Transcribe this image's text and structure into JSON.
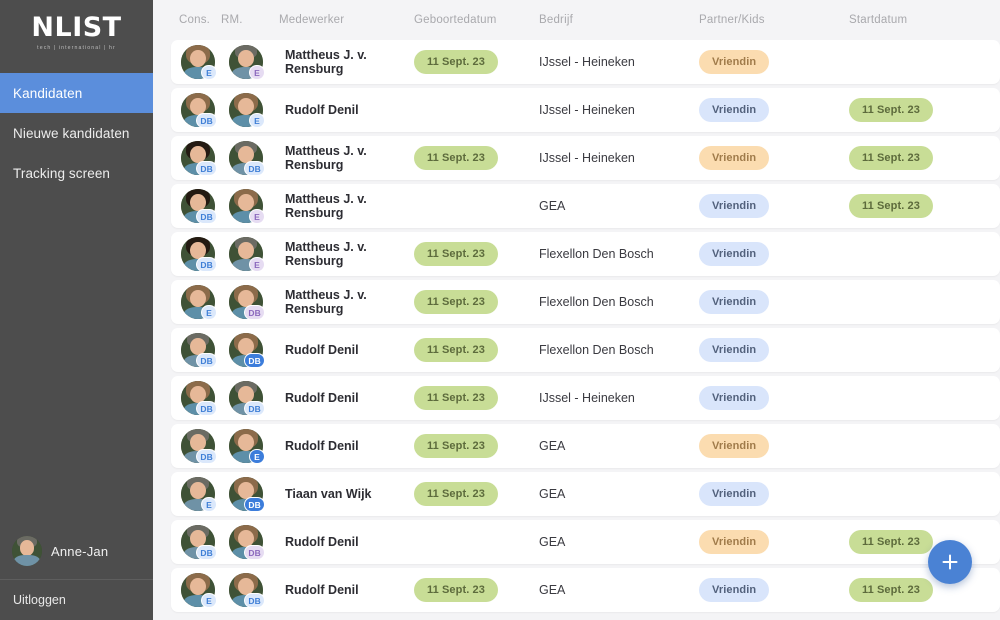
{
  "brand": {
    "logo": "NLIST",
    "tagline": "tech | international | hr"
  },
  "sidebar": {
    "items": [
      {
        "label": "Kandidaten",
        "active": true
      },
      {
        "label": "Nieuwe kandidaten",
        "active": false
      },
      {
        "label": "Tracking screen",
        "active": false
      }
    ],
    "user": {
      "name": "Anne-Jan"
    },
    "logout_label": "Uitloggen"
  },
  "colors": {
    "sidebar_bg": "#4d4d4d",
    "accent_blue": "#5b8edc",
    "page_bg": "#f4f4f6",
    "row_bg": "#ffffff",
    "chip_green_bg": "#c8dd96",
    "chip_green_text": "#5d6b3c",
    "chip_blue_bg": "#d9e5fb",
    "chip_blue_text": "#52617c",
    "chip_orange_bg": "#fbdcb0",
    "chip_orange_text": "#a07b4a",
    "fab_blue": "#4a82d4"
  },
  "table": {
    "columns": [
      {
        "key": "cons",
        "label": "Cons."
      },
      {
        "key": "rm",
        "label": "RM."
      },
      {
        "key": "name",
        "label": "Medewerker"
      },
      {
        "key": "geb",
        "label": "Geboortedatum"
      },
      {
        "key": "bedr",
        "label": "Bedrijf"
      },
      {
        "key": "part",
        "label": "Partner/Kids"
      },
      {
        "key": "start",
        "label": "Startdatum"
      }
    ],
    "rows": [
      {
        "cons_badge": "E",
        "cons_badge_style": "blue",
        "rm_badge": "E",
        "rm_badge_style": "purple",
        "name": "Mattheus J. v. Rensburg",
        "geboortedatum": "11 Sept. 23",
        "geboortedatum_style": "green",
        "bedrijf": "IJssel - Heineken",
        "partner": "Vriendin",
        "partner_style": "orange",
        "startdatum": "",
        "startdatum_style": "green",
        "face_cons": "l",
        "face_rm": "m"
      },
      {
        "cons_badge": "DB",
        "cons_badge_style": "blue",
        "rm_badge": "E",
        "rm_badge_style": "blue",
        "name": "Rudolf Denil",
        "geboortedatum": "",
        "geboortedatum_style": "green",
        "bedrijf": "IJssel - Heineken",
        "partner": "Vriendin",
        "partner_style": "blue",
        "startdatum": "11 Sept. 23",
        "startdatum_style": "green",
        "face_cons": "l",
        "face_rm": "l"
      },
      {
        "cons_badge": "DB",
        "cons_badge_style": "blue",
        "rm_badge": "DB",
        "rm_badge_style": "blue",
        "name": "Mattheus J. v. Rensburg",
        "geboortedatum": "11 Sept. 23",
        "geboortedatum_style": "green",
        "bedrijf": "IJssel - Heineken",
        "partner": "Vriendin",
        "partner_style": "orange",
        "startdatum": "11 Sept. 23",
        "startdatum_style": "green",
        "face_cons": "d",
        "face_rm": "m"
      },
      {
        "cons_badge": "DB",
        "cons_badge_style": "blue",
        "rm_badge": "E",
        "rm_badge_style": "purple",
        "name": "Mattheus J. v. Rensburg",
        "geboortedatum": "",
        "geboortedatum_style": "green",
        "bedrijf": "GEA",
        "partner": "Vriendin",
        "partner_style": "blue",
        "startdatum": "11 Sept. 23",
        "startdatum_style": "green",
        "face_cons": "d",
        "face_rm": "l"
      },
      {
        "cons_badge": "DB",
        "cons_badge_style": "blue",
        "rm_badge": "E",
        "rm_badge_style": "purple",
        "name": "Mattheus J. v. Rensburg",
        "geboortedatum": "11 Sept. 23",
        "geboortedatum_style": "green",
        "bedrijf": "Flexellon Den Bosch",
        "partner": "Vriendin",
        "partner_style": "blue",
        "startdatum": "",
        "startdatum_style": "green",
        "face_cons": "d",
        "face_rm": "m"
      },
      {
        "cons_badge": "E",
        "cons_badge_style": "blue",
        "rm_badge": "DB",
        "rm_badge_style": "purple",
        "name": "Mattheus J. v. Rensburg",
        "geboortedatum": "11 Sept. 23",
        "geboortedatum_style": "green",
        "bedrijf": "Flexellon Den Bosch",
        "partner": "Vriendin",
        "partner_style": "blue",
        "startdatum": "",
        "startdatum_style": "green",
        "face_cons": "l",
        "face_rm": "l"
      },
      {
        "cons_badge": "DB",
        "cons_badge_style": "blue",
        "rm_badge": "DB",
        "rm_badge_style": "solid",
        "name": "Rudolf Denil",
        "geboortedatum": "11 Sept. 23",
        "geboortedatum_style": "green",
        "bedrijf": "Flexellon Den Bosch",
        "partner": "Vriendin",
        "partner_style": "blue",
        "startdatum": "",
        "startdatum_style": "green",
        "face_cons": "m",
        "face_rm": "l"
      },
      {
        "cons_badge": "DB",
        "cons_badge_style": "blue",
        "rm_badge": "DB",
        "rm_badge_style": "blue",
        "name": "Rudolf Denil",
        "geboortedatum": "11 Sept. 23",
        "geboortedatum_style": "green",
        "bedrijf": "IJssel - Heineken",
        "partner": "Vriendin",
        "partner_style": "blue",
        "startdatum": "",
        "startdatum_style": "green",
        "face_cons": "l",
        "face_rm": "m"
      },
      {
        "cons_badge": "DB",
        "cons_badge_style": "blue",
        "rm_badge": "E",
        "rm_badge_style": "solid",
        "name": "Rudolf Denil",
        "geboortedatum": "11 Sept. 23",
        "geboortedatum_style": "green",
        "bedrijf": "GEA",
        "partner": "Vriendin",
        "partner_style": "orange",
        "startdatum": "",
        "startdatum_style": "green",
        "face_cons": "m",
        "face_rm": "l"
      },
      {
        "cons_badge": "E",
        "cons_badge_style": "blue",
        "rm_badge": "DB",
        "rm_badge_style": "solid",
        "name": "Tiaan van Wijk",
        "geboortedatum": "11 Sept. 23",
        "geboortedatum_style": "green",
        "bedrijf": "GEA",
        "partner": "Vriendin",
        "partner_style": "blue",
        "startdatum": "",
        "startdatum_style": "green",
        "face_cons": "m",
        "face_rm": "l"
      },
      {
        "cons_badge": "DB",
        "cons_badge_style": "blue",
        "rm_badge": "DB",
        "rm_badge_style": "purple",
        "name": "Rudolf Denil",
        "geboortedatum": "",
        "geboortedatum_style": "green",
        "bedrijf": "GEA",
        "partner": "Vriendin",
        "partner_style": "orange",
        "startdatum": "11 Sept. 23",
        "startdatum_style": "green",
        "face_cons": "m",
        "face_rm": "l"
      },
      {
        "cons_badge": "E",
        "cons_badge_style": "blue",
        "rm_badge": "DB",
        "rm_badge_style": "blue",
        "name": "Rudolf Denil",
        "geboortedatum": "11 Sept. 23",
        "geboortedatum_style": "green",
        "bedrijf": "GEA",
        "partner": "Vriendin",
        "partner_style": "blue",
        "startdatum": "11 Sept. 23",
        "startdatum_style": "green",
        "face_cons": "l",
        "face_rm": "l"
      }
    ]
  },
  "fab": {
    "icon": "plus-icon",
    "label": "+"
  }
}
